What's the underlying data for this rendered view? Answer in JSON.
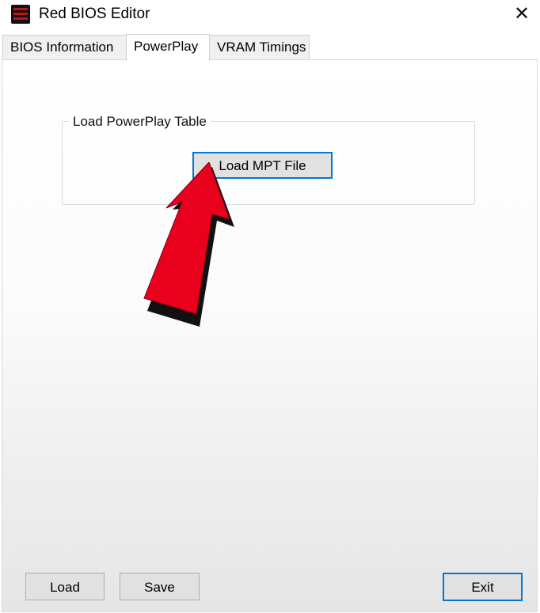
{
  "window": {
    "title": "Red BIOS Editor",
    "close_glyph": "✕",
    "icon": "red-bios-editor-app-icon"
  },
  "tabs": [
    {
      "label": "BIOS Information",
      "active": false
    },
    {
      "label": "PowerPlay",
      "active": true
    },
    {
      "label": "VRAM Timings",
      "active": false
    }
  ],
  "powerplay": {
    "group_label": "Load PowerPlay Table",
    "load_mpt_label": "Load MPT File"
  },
  "footer": {
    "load_label": "Load",
    "save_label": "Save",
    "exit_label": "Exit"
  },
  "annotation": {
    "arrow_icon": "red-arrow-pointer-icon",
    "arrow_color": "#e8001c"
  },
  "colors": {
    "focus_border": "#0078d7",
    "button_face": "#e1e1e1"
  }
}
